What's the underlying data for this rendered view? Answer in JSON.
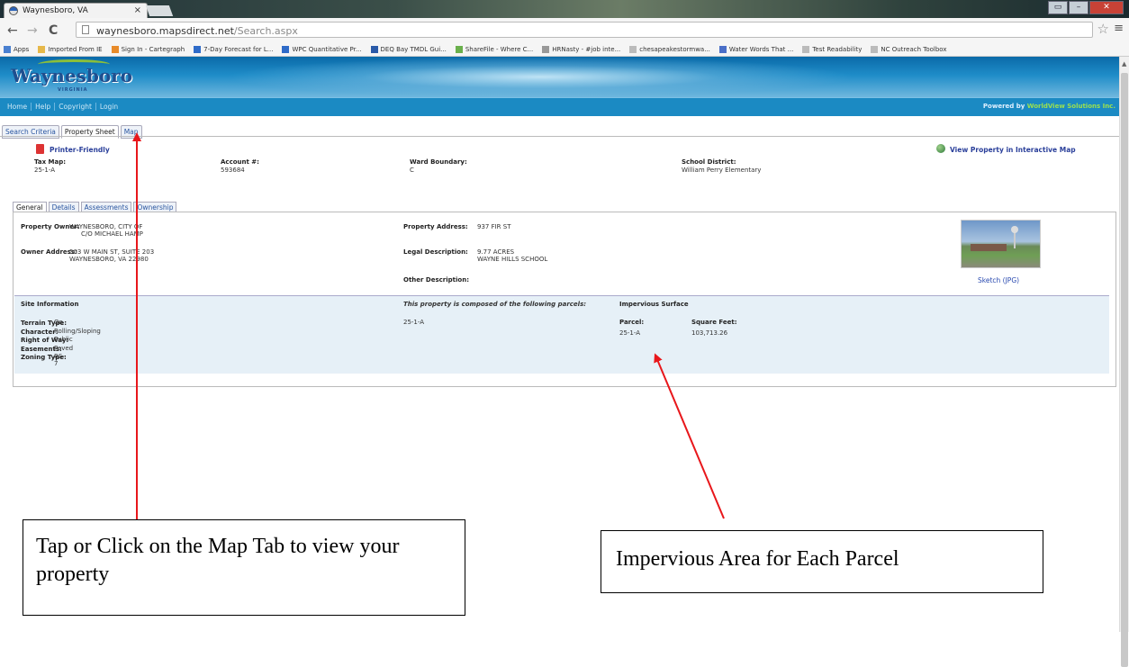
{
  "browser": {
    "tab_title": "Waynesboro, VA",
    "tab_close": "×",
    "url_host": "waynesboro.mapsdirect.net",
    "url_path": "/Search.aspx",
    "bookmarks": [
      {
        "label": "Apps",
        "color": "#4a80d0"
      },
      {
        "label": "Imported From IE",
        "color": "#e6b84a"
      },
      {
        "label": "Sign In - Cartegraph",
        "color": "#e88b2a"
      },
      {
        "label": "7-Day Forecast for L...",
        "color": "#2f6bc8"
      },
      {
        "label": "WPC Quantitative Pr...",
        "color": "#2f6bc8"
      },
      {
        "label": "DEQ Bay TMDL Gui...",
        "color": "#2a5aa8"
      },
      {
        "label": "ShareFile - Where C...",
        "color": "#6ab04c"
      },
      {
        "label": "HRNasty - #job inte...",
        "color": "#999999"
      },
      {
        "label": "chesapeakestormwa...",
        "color": "#bbbbbb"
      },
      {
        "label": "Water Words That ...",
        "color": "#4a6fc8"
      },
      {
        "label": "Test Readability",
        "color": "#bbbbbb"
      },
      {
        "label": "NC Outreach Toolbox",
        "color": "#bbbbbb"
      }
    ]
  },
  "site": {
    "logo_text": "Waynesboro",
    "logo_sub": "VIRGINIA",
    "nav_links": [
      "Home",
      "Help",
      "Copyright",
      "Login"
    ],
    "powered_prefix": "Powered by ",
    "powered_brand": "WorldView Solutions Inc."
  },
  "search_tabs": [
    {
      "label": "Search Criteria",
      "active": false
    },
    {
      "label": "Property Sheet",
      "active": true
    },
    {
      "label": "Map",
      "active": false
    }
  ],
  "sheet": {
    "printer_friendly": "Printer-Friendly",
    "view_interactive": "View Property in Interactive Map",
    "tax_map_label": "Tax Map:",
    "tax_map_value": "25-1-A",
    "account_label": "Account #:",
    "account_value": "593684",
    "ward_label": "Ward Boundary:",
    "ward_value": "C",
    "school_label": "School District:",
    "school_value": "William Perry Elementary"
  },
  "sub_tabs": [
    {
      "label": "General",
      "active": true
    },
    {
      "label": "Details",
      "active": false
    },
    {
      "label": "Assessments",
      "active": false
    },
    {
      "label": "Ownership",
      "active": false
    }
  ],
  "general": {
    "owner_label": "Property Owner:",
    "owner_line1": "WAYNESBORO, CITY OF",
    "owner_line2": "C/O MICHAEL HAMP",
    "owner_addr_label": "Owner Address:",
    "owner_addr_line1": "503 W MAIN ST, SUITE 203",
    "owner_addr_line2": "WAYNESBORO, VA 22980",
    "prop_addr_label": "Property Address:",
    "prop_addr_value": "937 FIR ST",
    "legal_label": "Legal Description:",
    "legal_line1": "9.77 ACRES",
    "legal_line2": "WAYNE HILLS SCHOOL",
    "other_label": "Other Description:",
    "sketch_link": "Sketch (JPG)"
  },
  "site_info": {
    "title": "Site Information",
    "rows": [
      {
        "label": "Terrain Type:",
        "value": "On"
      },
      {
        "label": "Character:",
        "value": "Rolling/Sloping"
      },
      {
        "label": "Right of Way:",
        "value": "Public"
      },
      {
        "label": "Easements:",
        "value": "Paved"
      },
      {
        "label": "Zoning Type:",
        "value": "RS-7"
      }
    ],
    "parcels_heading": "This property is composed of the following parcels:",
    "parcel_value": "25-1-A",
    "impervious_title": "Impervious Surface",
    "parcel_col": "Parcel:",
    "sqft_col": "Square Feet:",
    "imp_parcel": "25-1-A",
    "imp_sqft": "103,713.26"
  },
  "annotations": {
    "callout_left": "Tap or Click on the Map Tab to view your property",
    "callout_right": "Impervious Area for Each Parcel",
    "arrow_color": "#e8171b"
  }
}
